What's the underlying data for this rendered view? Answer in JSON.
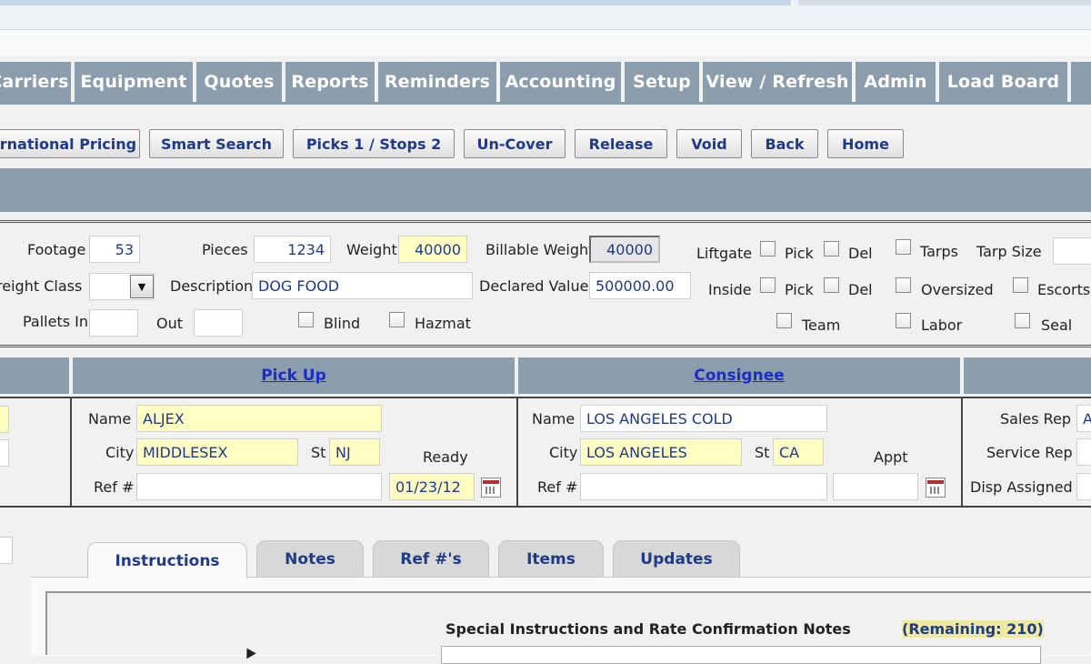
{
  "nav": {
    "tabs": [
      "Carriers",
      "Equipment",
      "Quotes",
      "Reports",
      "Reminders",
      "Accounting",
      "Setup",
      "View / Refresh",
      "Admin",
      "Load Board"
    ]
  },
  "actions": {
    "buttons": [
      "International Pricing",
      "Smart Search",
      "Picks 1 / Stops 2",
      "Un-Cover",
      "Release",
      "Void",
      "Back",
      "Home"
    ]
  },
  "details": {
    "footage_label": "Footage",
    "footage_value": "53",
    "pieces_label": "Pieces",
    "pieces_value": "1234",
    "weight_label": "Weight",
    "weight_value": "40000",
    "billable_label": "Billable Weight",
    "billable_value": "40000",
    "freight_class_label": "Freight Class",
    "freight_class_value": "",
    "description_label": "Description",
    "description_value": "DOG FOOD",
    "declared_label": "Declared Value",
    "declared_value": "500000.00",
    "pallets_in_label": "Pallets In",
    "pallets_in_value": "",
    "out_label": "Out",
    "out_value": "",
    "blind_label": "Blind",
    "hazmat_label": "Hazmat",
    "liftgate_label": "Liftgate",
    "inside_label": "Inside",
    "pick_label": "Pick",
    "del_label": "Del",
    "tarps_label": "Tarps",
    "tarp_size_label": "Tarp Size",
    "oversized_label": "Oversized",
    "escorts_label": "Escorts",
    "team_label": "Team",
    "labor_label": "Labor",
    "seal_label": "Seal"
  },
  "pickup": {
    "header": "Pick Up",
    "name_label": "Name",
    "name_value": "ALJEX",
    "city_label": "City",
    "city_value": "MIDDLESEX",
    "st_label": "St",
    "st_value": "NJ",
    "ref_label": "Ref #",
    "ref_value": "",
    "ready_label": "Ready",
    "ready_value": "01/23/12"
  },
  "consignee": {
    "header": "Consignee",
    "name_label": "Name",
    "name_value": "LOS ANGELES COLD",
    "city_label": "City",
    "city_value": "LOS ANGELES",
    "st_label": "St",
    "st_value": "CA",
    "ref_label": "Ref #",
    "ref_value": "",
    "appt_label": "Appt",
    "appt_value": ""
  },
  "reps": {
    "sales_label": "Sales Rep",
    "sales_value": "A",
    "service_label": "Service Rep",
    "disp_label": "Disp Assigned"
  },
  "tabs": [
    "Instructions",
    "Notes",
    "Ref #'s",
    "Items",
    "Updates"
  ],
  "instructions": {
    "title": "Special Instructions and Rate Confirmation Notes",
    "remaining": "(Remaining: 210)"
  },
  "colors": {
    "nav_bg": "#8c9ead",
    "accent_text": "#1e3a88",
    "highlight": "#ffffc4",
    "link": "#1a2ccc"
  }
}
